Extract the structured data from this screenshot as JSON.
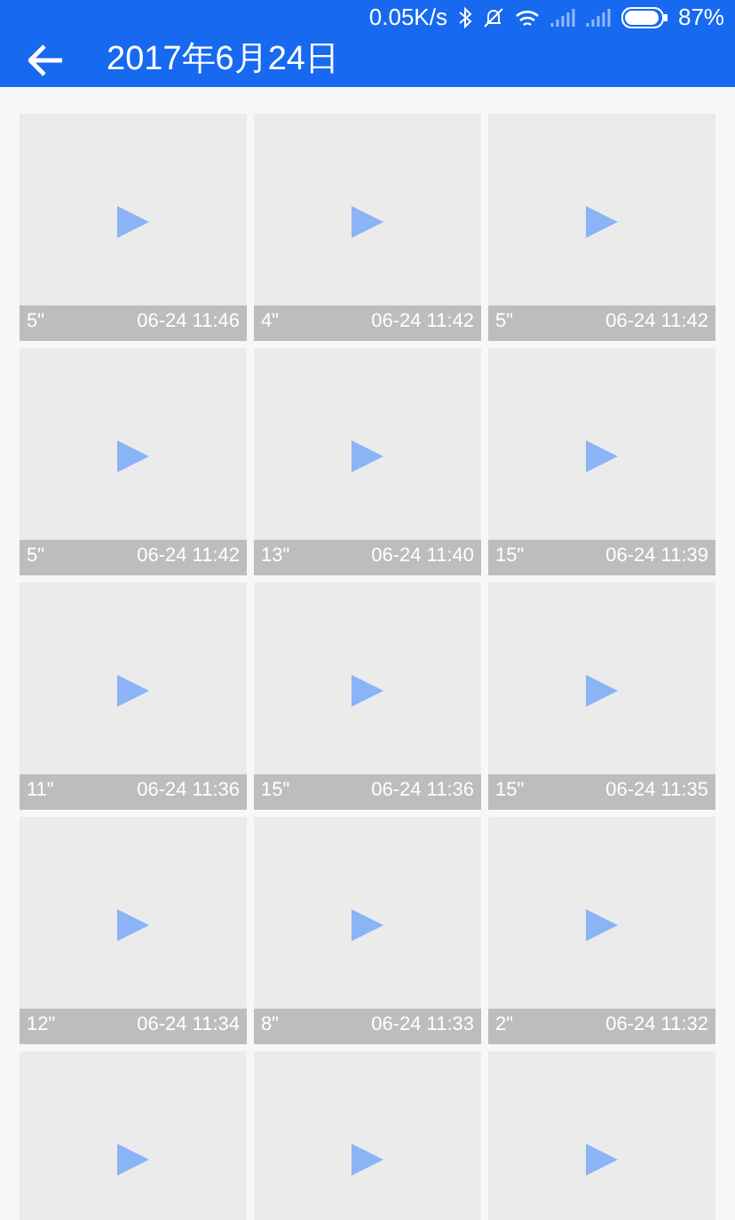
{
  "status_bar": {
    "speed": "0.05K/s",
    "battery": "87%"
  },
  "header": {
    "title": "2017年6月24日"
  },
  "videos": [
    {
      "kind": "video",
      "duration": "5\"",
      "time": "06-24 11:46"
    },
    {
      "kind": "video",
      "duration": "4\"",
      "time": "06-24 11:42"
    },
    {
      "kind": "video",
      "duration": "5\"",
      "time": "06-24 11:42"
    },
    {
      "kind": "video",
      "duration": "5\"",
      "time": "06-24 11:42"
    },
    {
      "kind": "video",
      "duration": "13\"",
      "time": "06-24 11:40"
    },
    {
      "kind": "video",
      "duration": "15\"",
      "time": "06-24 11:39"
    },
    {
      "kind": "video",
      "duration": "11\"",
      "time": "06-24 11:36"
    },
    {
      "kind": "video",
      "duration": "15\"",
      "time": "06-24 11:36"
    },
    {
      "kind": "video",
      "duration": "15\"",
      "time": "06-24 11:35"
    },
    {
      "kind": "video",
      "duration": "12\"",
      "time": "06-24 11:34"
    },
    {
      "kind": "video",
      "duration": "8\"",
      "time": "06-24 11:33"
    },
    {
      "kind": "video",
      "duration": "2\"",
      "time": "06-24 11:32"
    },
    {
      "kind": "video"
    },
    {
      "kind": "video"
    },
    {
      "kind": "video"
    }
  ]
}
